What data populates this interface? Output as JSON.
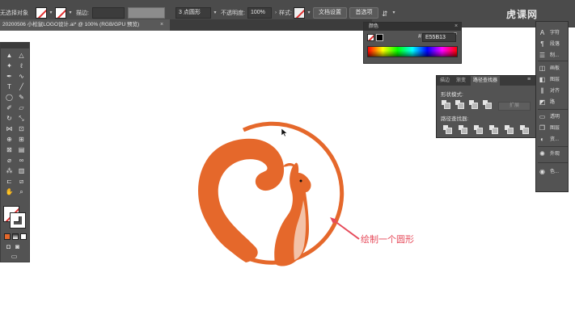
{
  "control_bar": {
    "selection_label": "无选择对象",
    "stroke_label": "描边:",
    "brush_label": "3 点圆形",
    "opacity_label": "不透明度:",
    "opacity_value": "100%",
    "style_label": "样式:",
    "doc_setup_button": "文档设置",
    "prefs_button": "首选项"
  },
  "document_tab": {
    "title": "20200506 小松鼠LOGO设计.ai* @ 100% (RGB/GPU 预览)",
    "close_glyph": "×"
  },
  "tools_panel": {
    "icons": [
      "selection-icon",
      "direct-selection-icon",
      "magic-wand-icon",
      "lasso-icon",
      "pen-icon",
      "curvature-icon",
      "type-icon",
      "line-icon",
      "ellipse-icon",
      "brush-icon",
      "shaper-icon",
      "eraser-icon",
      "rotate-icon",
      "scale-icon",
      "width-icon",
      "free-transform-icon",
      "shape-builder-icon",
      "perspective-icon",
      "mesh-icon",
      "gradient-icon",
      "eyedropper-icon",
      "blend-icon",
      "symbol-sprayer-icon",
      "column-graph-icon",
      "artboard-icon",
      "slice-icon",
      "hand-icon",
      "zoom-icon"
    ]
  },
  "color_panel": {
    "tab": "颜色",
    "hex_prefix": "#",
    "hex_value": "E55B13",
    "close_glyph": "×",
    "menu_glyph": "≡"
  },
  "pathfinder_panel": {
    "tabs": [
      "描边",
      "渐变",
      "路径查找器"
    ],
    "active_tab_index": 2,
    "shape_modes_label": "形状模式:",
    "pathfinders_label": "路径查找器:",
    "expand_button": "扩展",
    "menu_glyph": "≡"
  },
  "right_dock": {
    "items": [
      {
        "icon": "A",
        "label": "字符"
      },
      {
        "icon": "¶",
        "label": "段落"
      },
      {
        "icon": "☰",
        "label": "制..."
      },
      {
        "icon": "◫",
        "label": "画板"
      },
      {
        "icon": "◧",
        "label": "图层"
      },
      {
        "icon": "⫼",
        "label": "对齐"
      },
      {
        "icon": "◩",
        "label": "路"
      },
      {
        "icon": "▭",
        "label": "透明"
      },
      {
        "icon": "❐",
        "label": "图层"
      },
      {
        "icon": "◐",
        "label": "资..."
      },
      {
        "icon": "✺",
        "label": "外观"
      },
      {
        "icon": "◉",
        "label": "色..."
      }
    ]
  },
  "watermark": "虎课网",
  "annotation": "绘制一个圆形",
  "colors": {
    "accent": "#E55B13",
    "logo_orange": "#E5682B",
    "annotation": "#E64A5A",
    "chest": "#F3C2A8"
  }
}
